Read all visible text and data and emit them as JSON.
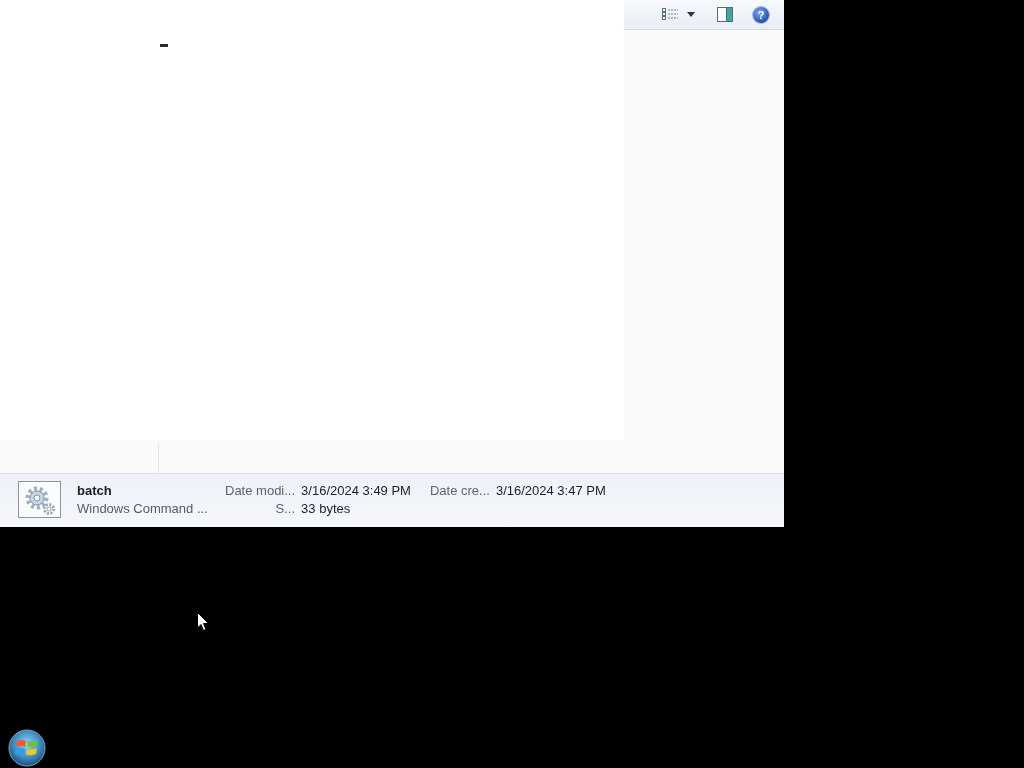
{
  "explorer": {
    "toolbar": {
      "help_label": "?"
    },
    "details_pane": {
      "file_name": "batch",
      "file_type": "Windows Command ...",
      "property_columns": [
        [
          {
            "label": "Date modi...",
            "value": "3/16/2024 3:49 PM"
          },
          {
            "label": "S...",
            "value": "33 bytes"
          }
        ],
        [
          {
            "label": "Date cre...",
            "value": "3/16/2024 3:47 PM"
          }
        ]
      ]
    }
  }
}
